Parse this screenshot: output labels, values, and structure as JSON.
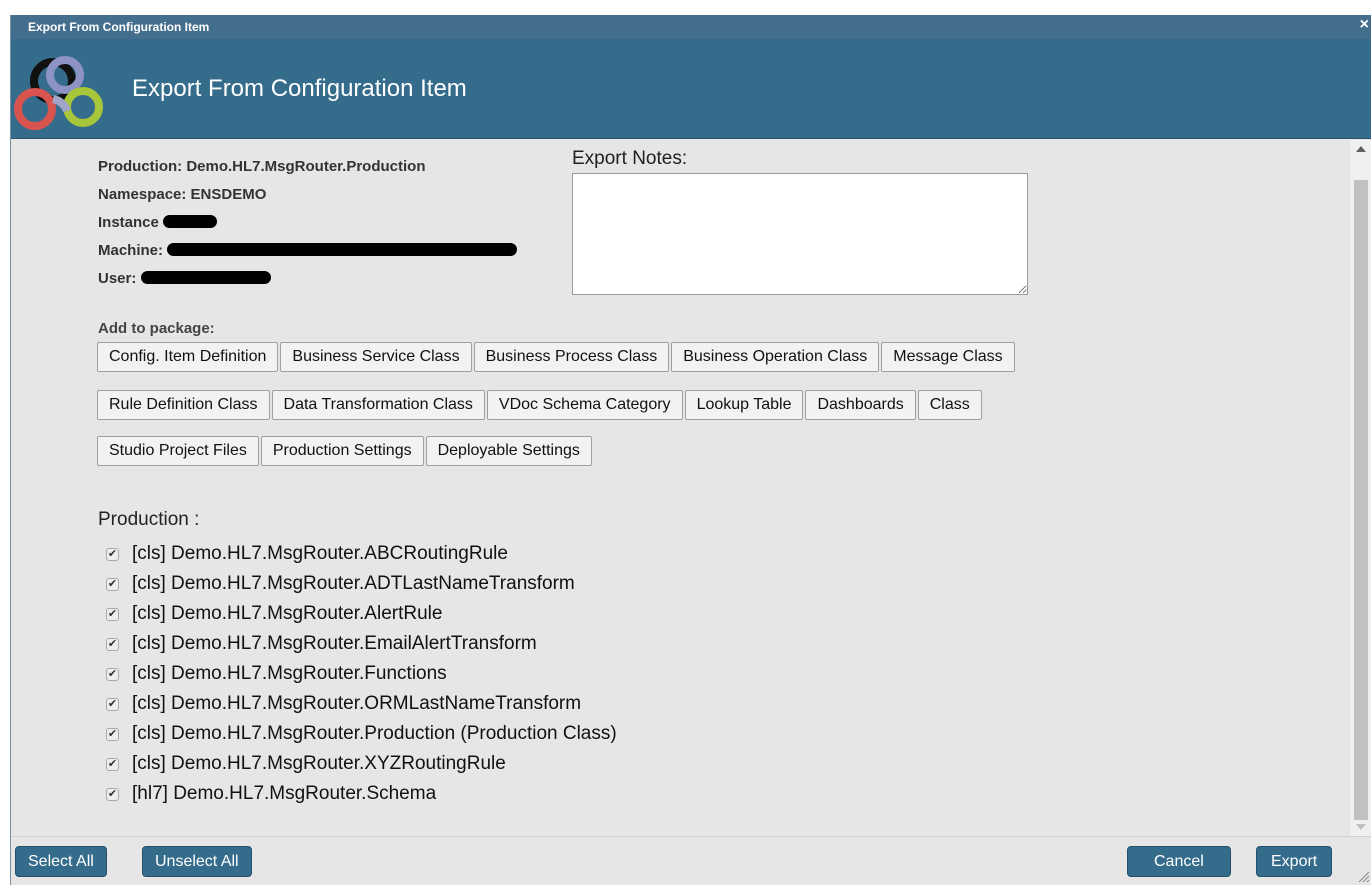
{
  "window": {
    "title": "Export From Configuration Item",
    "close_glyph": "×",
    "header_title": "Export From Configuration Item",
    "logo_icon": "intersystems-logo-icon"
  },
  "info": {
    "production": "Production: Demo.HL7.MsgRouter.Production",
    "namespace": "Namespace: ENSDEMO",
    "instance_label": "Instance",
    "machine_label": "Machine:",
    "user_label": "User:"
  },
  "notes": {
    "label": "Export Notes:",
    "value": ""
  },
  "package": {
    "label": "Add to package:",
    "row1": [
      "Config. Item Definition",
      "Business Service Class",
      "Business Process Class",
      "Business Operation Class",
      "Message Class"
    ],
    "row2": [
      "Rule Definition Class",
      "Data Transformation Class",
      "VDoc Schema Category",
      "Lookup Table",
      "Dashboards",
      "Class"
    ],
    "row3": [
      "Studio Project Files",
      "Production Settings",
      "Deployable Settings"
    ]
  },
  "production_list": {
    "label": "Production :",
    "items": [
      "[cls] Demo.HL7.MsgRouter.ABCRoutingRule",
      "[cls] Demo.HL7.MsgRouter.ADTLastNameTransform",
      "[cls] Demo.HL7.MsgRouter.AlertRule",
      "[cls] Demo.HL7.MsgRouter.EmailAlertTransform",
      "[cls] Demo.HL7.MsgRouter.Functions",
      "[cls] Demo.HL7.MsgRouter.ORMLastNameTransform",
      "[cls] Demo.HL7.MsgRouter.Production (Production Class)",
      "[cls] Demo.HL7.MsgRouter.XYZRoutingRule",
      "[hl7] Demo.HL7.MsgRouter.Schema"
    ]
  },
  "footer": {
    "select_all": "Select All",
    "unselect_all": "Unselect All",
    "cancel": "Cancel",
    "export": "Export"
  },
  "colors": {
    "titlebar": "#446e8e",
    "header": "#356c8c",
    "button_primary": "#356c8c",
    "content_bg": "#e6e6e6"
  }
}
